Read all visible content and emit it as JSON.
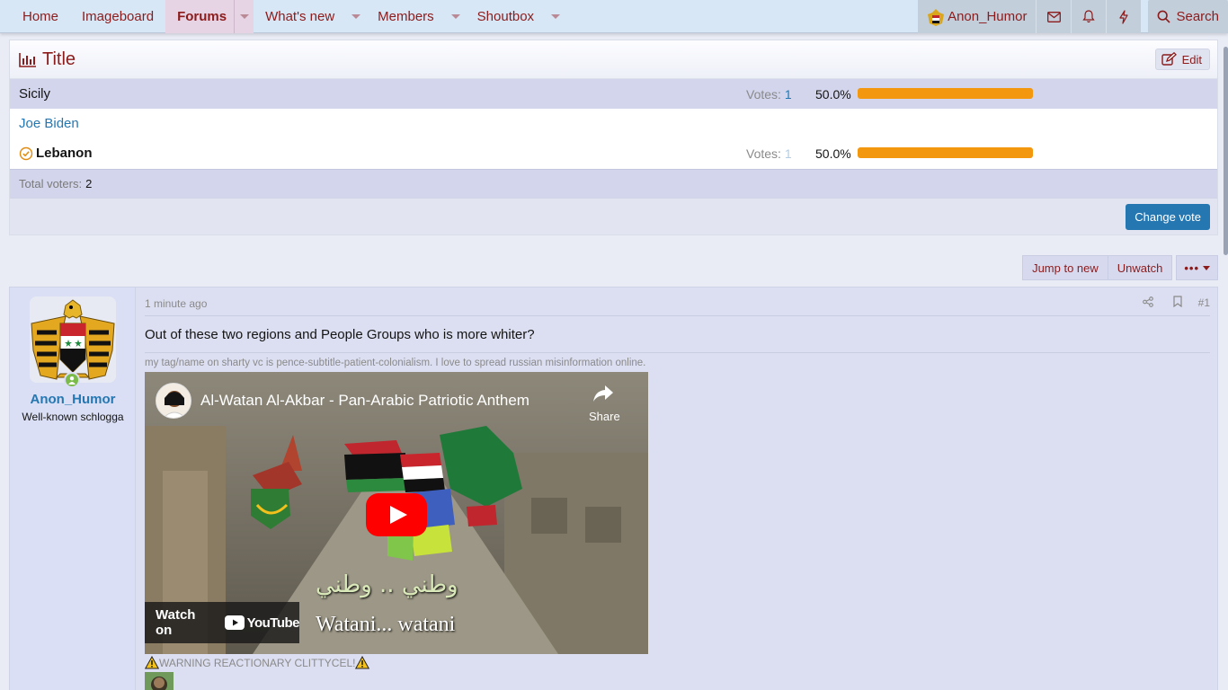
{
  "nav": {
    "items": [
      {
        "label": "Home"
      },
      {
        "label": "Imageboard"
      },
      {
        "label": "Forums"
      },
      {
        "label": "What's new"
      },
      {
        "label": "Members"
      },
      {
        "label": "Shoutbox"
      }
    ],
    "username": "Anon_Humor",
    "search_label": "Search"
  },
  "poll": {
    "title": "Title",
    "edit_label": "Edit",
    "votes_label": "Votes:",
    "options": [
      {
        "label": "Sicily",
        "votes": "1",
        "percent": "50.0%",
        "fraction": 0.5
      },
      {
        "label": "Joe Biden"
      },
      {
        "label": "Lebanon",
        "votes": "1",
        "percent": "50.0%",
        "fraction": 0.5
      }
    ],
    "total_label": "Total voters:",
    "total_value": "2",
    "change_vote_label": "Change vote"
  },
  "thread_actions": {
    "jump_to_new": "Jump to new",
    "unwatch": "Unwatch",
    "more": "•••"
  },
  "post": {
    "username": "Anon_Humor",
    "user_title": "Well-known schlogga",
    "time": "1 minute ago",
    "number": "#1",
    "body": "Out of these two regions and People Groups who is more whiter?",
    "signature": "my tag/name on sharty vc is pence-subtitle-patient-colonialism. I love to spread russian misinformation online.",
    "video": {
      "title": "Al-Watan Al-Akbar - Pan-Arabic Patriotic Anthem",
      "share": "Share",
      "watch_on": "Watch on",
      "youtube": "YouTube",
      "subtitle_ar": "وطني .. وطني",
      "subtitle_en": "Watani... watani"
    },
    "warning": "WARNING REACTIONARY CLITTYCEL!"
  },
  "colors": {
    "accent": "#8c1b1b",
    "link": "#2577b1",
    "bar": "#f3970e"
  }
}
